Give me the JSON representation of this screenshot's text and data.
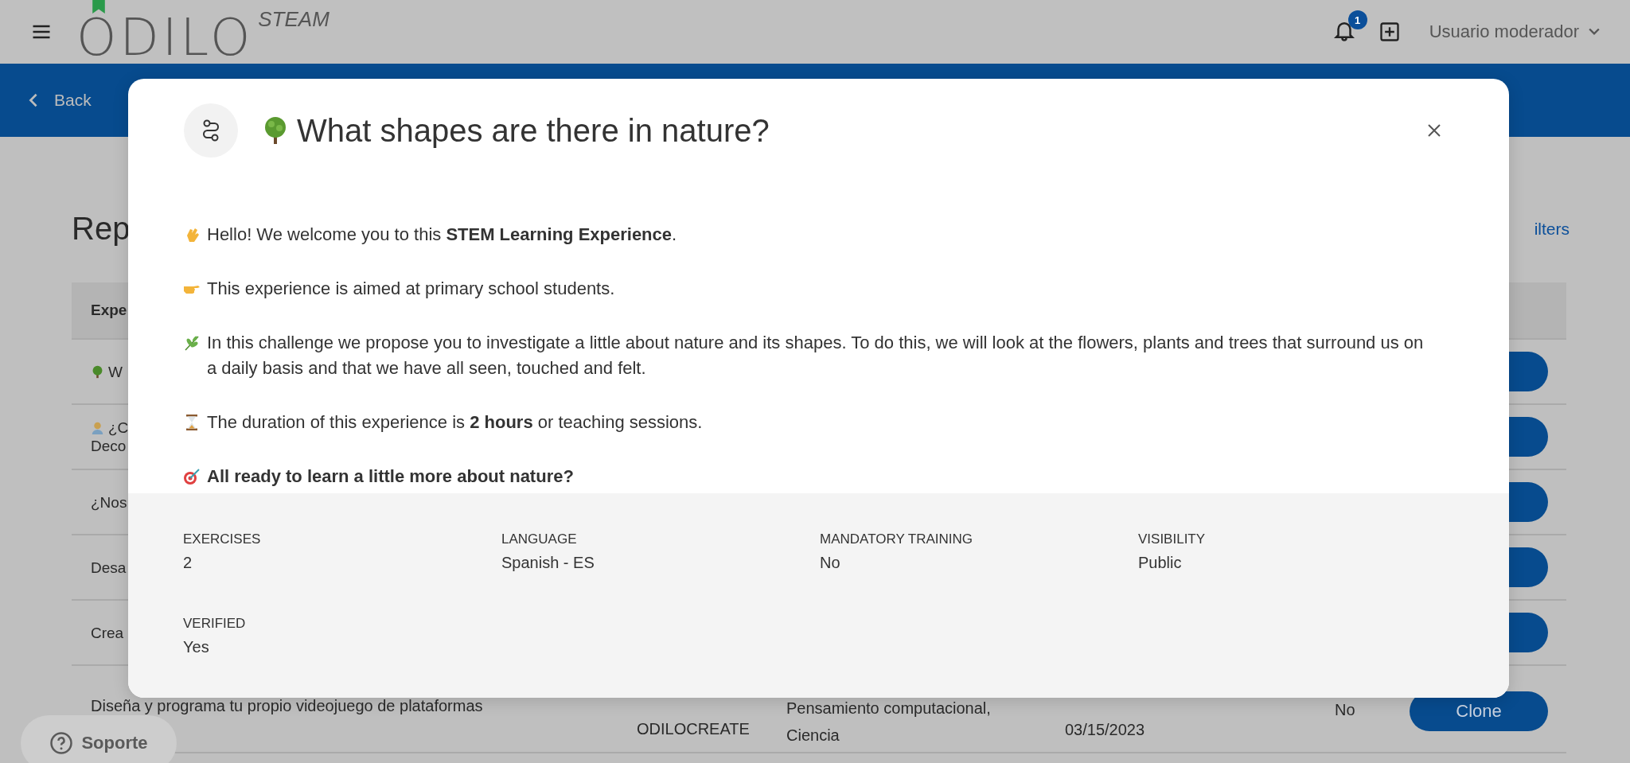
{
  "header": {
    "logo": "ODILO",
    "logo_sub": "STEAM",
    "notification_count": "1",
    "user": "Usuario moderador"
  },
  "nav": {
    "back": "Back"
  },
  "page": {
    "title": "Rep",
    "filters_link": "ilters",
    "table": {
      "columns": [
        "Expe"
      ],
      "rows": [
        {
          "experience": [
            "W"
          ]
        },
        {
          "experience": [
            "¿C",
            "Deco"
          ]
        },
        {
          "experience": [
            "¿Nos"
          ]
        },
        {
          "experience": [
            "Desa"
          ]
        },
        {
          "experience": [
            "Crea"
          ]
        },
        {
          "experience": [
            "Diseña y programa tu propio videojuego de plataformas"
          ],
          "platform": "ODILOCREATE",
          "categories": [
            "Pensamiento computacional,",
            "Ciencia"
          ],
          "date": "03/15/2023",
          "verified": "No",
          "action": "Clone"
        }
      ]
    }
  },
  "support": {
    "label": "Soporte"
  },
  "modal": {
    "title": "What shapes are there in nature?",
    "paragraphs": [
      {
        "text": "Hello! We welcome you to this **STEM Learning Experience**.",
        "bold": false
      },
      {
        "text": "This experience is aimed at primary school students.",
        "bold": false
      },
      {
        "text": "In this challenge we propose you to investigate a little about nature and its shapes. To do this, we will look at the flowers, plants and trees that surround us on a daily basis and that we have all seen, touched and felt.",
        "bold": false
      },
      {
        "text": "The duration of this experience is **2 hours** or teaching sessions.",
        "bold": false
      },
      {
        "text": "All ready to learn a little more about nature?",
        "bold": true
      }
    ],
    "details": [
      {
        "label": "EXERCISES",
        "value": "2"
      },
      {
        "label": "LANGUAGE",
        "value": "Spanish - ES"
      },
      {
        "label": "MANDATORY TRAINING",
        "value": "No"
      },
      {
        "label": "VISIBILITY",
        "value": "Public"
      },
      {
        "label": "VERIFIED",
        "value": "Yes"
      }
    ]
  }
}
